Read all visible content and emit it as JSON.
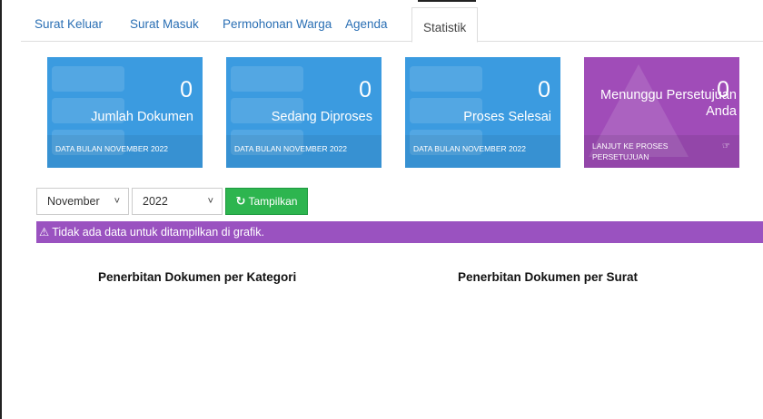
{
  "tabs": [
    {
      "label": "Surat Keluar"
    },
    {
      "label": "Surat Masuk"
    },
    {
      "label": "Permohonan Warga"
    },
    {
      "label": "Agenda"
    },
    {
      "label": "Statistik",
      "active": true
    }
  ],
  "stats": [
    {
      "value": "0",
      "label": "Jumlah Dokumen",
      "footer": "DATA BULAN NOVEMBER 2022",
      "color": "#3b9be0"
    },
    {
      "value": "0",
      "label": "Sedang Diproses",
      "footer": "DATA BULAN NOVEMBER 2022",
      "color": "#3b9be0"
    },
    {
      "value": "0",
      "label": "Proses Selesai",
      "footer": "DATA BULAN NOVEMBER 2022",
      "color": "#3b9be0"
    },
    {
      "value": "0",
      "label": "Menunggu Persetujuan Anda",
      "footer": "LANJUT KE PROSES PERSETUJUAN",
      "color": "#a04cb8",
      "footer_icon": "hand-pointer-icon"
    }
  ],
  "filter": {
    "month_selected": "November",
    "year_selected": "2022",
    "button_label": "Tampilkan",
    "button_icon": "refresh-icon",
    "button_color": "#2db54f"
  },
  "alert": {
    "icon": "warning-icon",
    "text": "Tidak ada data untuk ditampilkan di grafik.",
    "color": "#9a52c0"
  },
  "charts": {
    "by_category_title": "Penerbitan Dokumen per Kategori",
    "by_letter_title": "Penerbitan Dokumen per Surat"
  }
}
